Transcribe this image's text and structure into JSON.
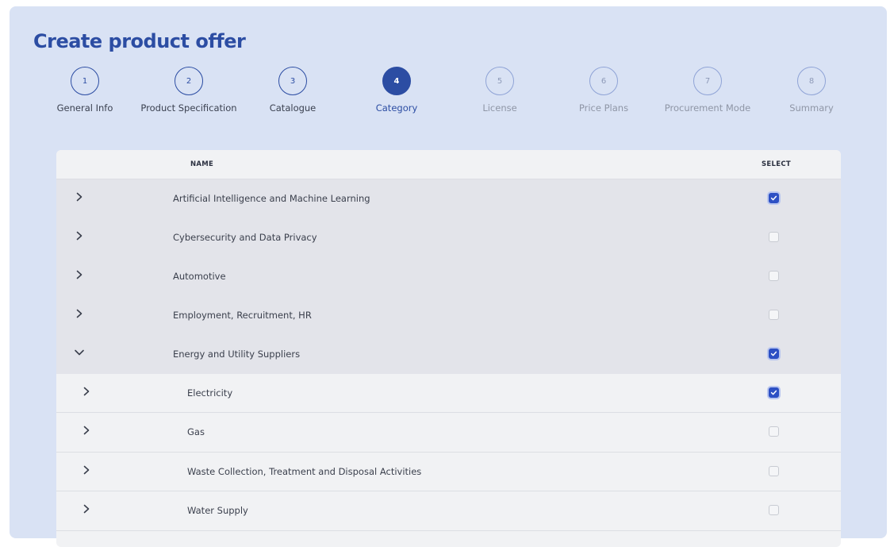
{
  "page": {
    "title": "Create product offer"
  },
  "stepper": {
    "steps": [
      {
        "number": "1",
        "label": "General Info",
        "state": "done"
      },
      {
        "number": "2",
        "label": "Product Specification",
        "state": "done"
      },
      {
        "number": "3",
        "label": "Catalogue",
        "state": "done"
      },
      {
        "number": "4",
        "label": "Category",
        "state": "active"
      },
      {
        "number": "5",
        "label": "License",
        "state": "future"
      },
      {
        "number": "6",
        "label": "Price Plans",
        "state": "future"
      },
      {
        "number": "7",
        "label": "Procurement Mode",
        "state": "future"
      },
      {
        "number": "8",
        "label": "Summary",
        "state": "future"
      }
    ]
  },
  "table": {
    "columns": {
      "name": "NAME",
      "select": "SELECT"
    },
    "rows": [
      {
        "label": "Artificial Intelligence and Machine Learning",
        "level": 0,
        "expanded": false,
        "checked": true
      },
      {
        "label": "Cybersecurity and Data Privacy",
        "level": 0,
        "expanded": false,
        "checked": false
      },
      {
        "label": "Automotive",
        "level": 0,
        "expanded": false,
        "checked": false
      },
      {
        "label": "Employment, Recruitment, HR",
        "level": 0,
        "expanded": false,
        "checked": false
      },
      {
        "label": "Energy and Utility Suppliers",
        "level": 0,
        "expanded": true,
        "checked": true
      },
      {
        "label": "Electricity",
        "level": 1,
        "expanded": false,
        "checked": true
      },
      {
        "label": "Gas",
        "level": 1,
        "expanded": false,
        "checked": false
      },
      {
        "label": "Waste Collection, Treatment and Disposal Activities",
        "level": 1,
        "expanded": false,
        "checked": false
      },
      {
        "label": "Water Supply",
        "level": 1,
        "expanded": false,
        "checked": false
      }
    ]
  },
  "colors": {
    "accent": "#2c4da3",
    "checkbox_checked": "#2d50c4",
    "panel_bg": "#d9e2f4"
  },
  "icons": {
    "collapsed": "chevron-right-icon",
    "expanded": "chevron-down-icon",
    "check": "check-icon"
  }
}
